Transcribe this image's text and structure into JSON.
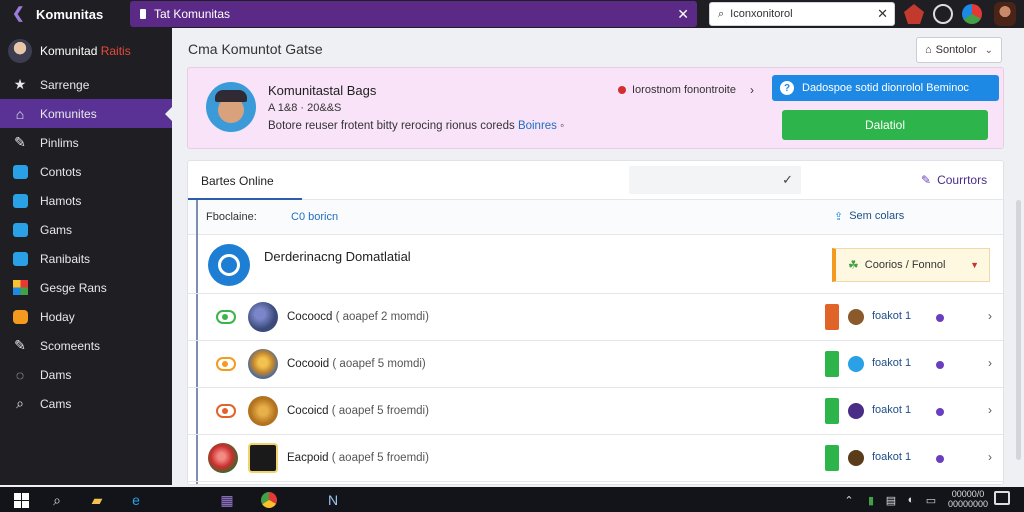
{
  "topbar": {
    "app_title": "Komunitas",
    "tab_title": "Tat Komunitas",
    "address_text": "Iconxonitorol"
  },
  "sidebar": {
    "profile_title": "Komunitad",
    "profile_accent": "Raitis",
    "items": [
      {
        "label": "Sarrenge",
        "icon": "star-icon"
      },
      {
        "label": "Komunites",
        "icon": "home-icon",
        "active": true
      },
      {
        "label": "Pinlims",
        "icon": "pin-icon"
      },
      {
        "label": "Contots",
        "icon": "contacts-icon"
      },
      {
        "label": "Hamots",
        "icon": "chat-icon"
      },
      {
        "label": "Gams",
        "icon": "games-icon"
      },
      {
        "label": "Ranibaits",
        "icon": "rainbow-icon"
      },
      {
        "label": "Gesge Rans",
        "icon": "grid-icon"
      },
      {
        "label": "Hoday",
        "icon": "calendar-icon"
      },
      {
        "label": "Scomeents",
        "icon": "wrench-icon"
      },
      {
        "label": "Dams",
        "icon": "chat-bubble-icon"
      },
      {
        "label": "Cams",
        "icon": "search-icon"
      }
    ]
  },
  "main": {
    "title": "Cma Komuntot Gatse",
    "sort_label": "Sontolor"
  },
  "hero": {
    "name": "Komunitastal Bags",
    "stats": "A 1&8 · 20&&S",
    "description": "Botore reuser frotent bitty rerocing rionus coreds",
    "description_link": "Boinres",
    "badge_text": "Iorostnom fonontroite",
    "info_bar_text": "Dadospoe sotid dionrolol   Beminoc",
    "cta_label": "Dalatiol"
  },
  "panel": {
    "tab_online": "Bartes Online",
    "counters_label": "Courrtors",
    "filter_label": "Fboclaine:",
    "filter_link": "C0 boricn",
    "sort_right": "Sem colars",
    "featured": {
      "title": "Derderinacng Domatlatial",
      "select_label": "Coorios / Fonnol"
    },
    "rows": [
      {
        "name": "Cocoocd",
        "meta": "( aoapef 2 momdi)",
        "toggle_color": "#3bb54a",
        "game_color": "#3a4a7a",
        "strip_color": "#e0632a",
        "user_color": "#8a5a2b",
        "user_label": "foakot 1"
      },
      {
        "name": "Cocooid",
        "meta": "( aoapef 5 momdi)",
        "toggle_color": "#f39a1f",
        "game_color": "#c2862f",
        "strip_color": "#2db44a",
        "user_color": "#2aa0e6",
        "user_label": "foakot 1"
      },
      {
        "name": "Cocoicd",
        "meta": "( aoapef 5 froemdi)",
        "toggle_color": "#e0632a",
        "game_color": "#b3721f",
        "strip_color": "#2db44a",
        "user_color": "#4a2d86",
        "user_label": "foakot 1"
      },
      {
        "name": "Eacpoid",
        "meta": "( aoapef 5 froemdi)",
        "toggle_color": "#cc2e2e",
        "game_color": "#1a1a1a",
        "strip_color": "#2db44a",
        "user_color": "#5a3b1a",
        "user_label": "foakot 1"
      }
    ]
  },
  "taskbar": {
    "time_line1": "00000/0",
    "time_line2": "00000000"
  }
}
